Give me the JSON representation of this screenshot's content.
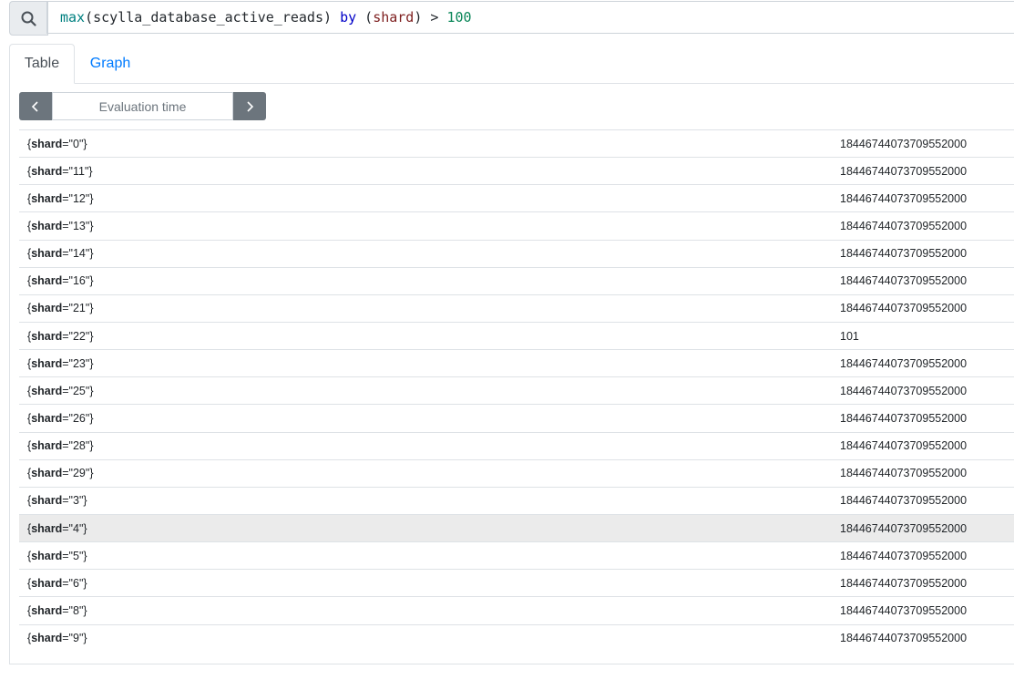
{
  "query": {
    "tokens": [
      {
        "text": "max",
        "kind": "fn"
      },
      {
        "text": "(scylla_database_active_reads) ",
        "kind": "plain"
      },
      {
        "text": "by",
        "kind": "kw"
      },
      {
        "text": " (",
        "kind": "plain"
      },
      {
        "text": "shard",
        "kind": "lbl"
      },
      {
        "text": ") > ",
        "kind": "plain"
      },
      {
        "text": "100",
        "kind": "num"
      }
    ]
  },
  "tabs": [
    {
      "label": "Table",
      "active": true
    },
    {
      "label": "Graph",
      "active": false
    }
  ],
  "time_controls": {
    "placeholder": "Evaluation time"
  },
  "label_name": "shard",
  "rows": [
    {
      "shard": "0",
      "value": "18446744073709552000"
    },
    {
      "shard": "11",
      "value": "18446744073709552000"
    },
    {
      "shard": "12",
      "value": "18446744073709552000"
    },
    {
      "shard": "13",
      "value": "18446744073709552000"
    },
    {
      "shard": "14",
      "value": "18446744073709552000"
    },
    {
      "shard": "16",
      "value": "18446744073709552000"
    },
    {
      "shard": "21",
      "value": "18446744073709552000"
    },
    {
      "shard": "22",
      "value": "101"
    },
    {
      "shard": "23",
      "value": "18446744073709552000"
    },
    {
      "shard": "25",
      "value": "18446744073709552000"
    },
    {
      "shard": "26",
      "value": "18446744073709552000"
    },
    {
      "shard": "28",
      "value": "18446744073709552000"
    },
    {
      "shard": "29",
      "value": "18446744073709552000"
    },
    {
      "shard": "3",
      "value": "18446744073709552000"
    },
    {
      "shard": "4",
      "value": "18446744073709552000",
      "highlighted": true
    },
    {
      "shard": "5",
      "value": "18446744073709552000"
    },
    {
      "shard": "6",
      "value": "18446744073709552000"
    },
    {
      "shard": "8",
      "value": "18446744073709552000"
    },
    {
      "shard": "9",
      "value": "18446744073709552000"
    }
  ]
}
